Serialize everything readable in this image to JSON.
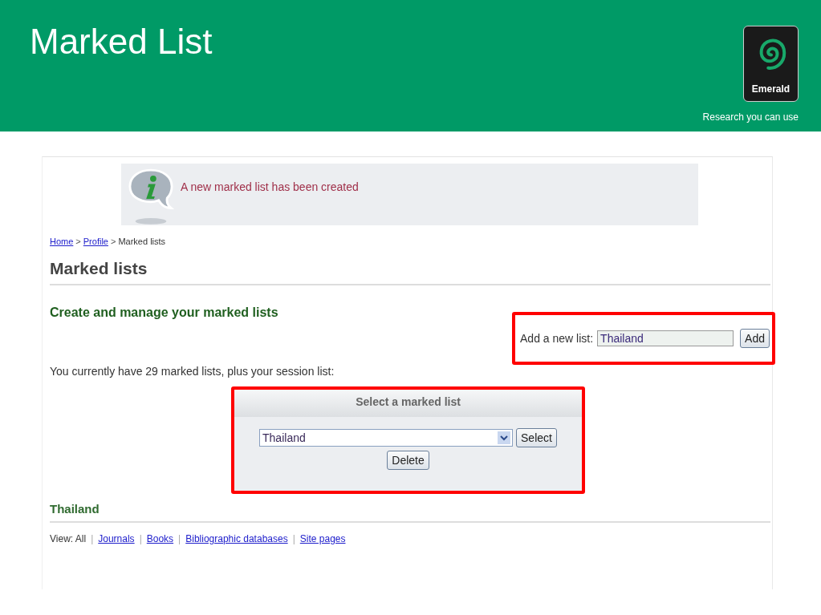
{
  "slide": {
    "title": "Marked List",
    "logo_text": "Emerald",
    "tagline": "Research you can use"
  },
  "notice": {
    "message": "A new marked list has been created"
  },
  "breadcrumb": [
    {
      "kind": "link",
      "text": "Home"
    },
    {
      "kind": "separator",
      "text": ">"
    },
    {
      "kind": "link",
      "text": "Profile"
    },
    {
      "kind": "separator",
      "text": ">"
    },
    {
      "kind": "text",
      "text": "Marked lists"
    }
  ],
  "page_title": "Marked lists",
  "section_title": "Create and manage your marked lists",
  "add_list": {
    "label": "Add a new list:",
    "value": "Thailand",
    "button": "Add",
    "highlighted": true
  },
  "summary": "You currently have 29 marked lists, plus your session list:",
  "select_panel": {
    "title": "Select a marked list",
    "selected_value": "Thailand",
    "select_button": "Select",
    "delete_button": "Delete",
    "highlighted": true
  },
  "current_list": {
    "title": "Thailand"
  },
  "view_filter": [
    {
      "kind": "text",
      "text": "View: All"
    },
    {
      "kind": "separator",
      "text": "|"
    },
    {
      "kind": "link",
      "text": "Journals"
    },
    {
      "kind": "separator",
      "text": "|"
    },
    {
      "kind": "link",
      "text": "Books"
    },
    {
      "kind": "separator",
      "text": "|"
    },
    {
      "kind": "link",
      "text": "Bibliographic databases"
    },
    {
      "kind": "separator",
      "text": "|"
    },
    {
      "kind": "link",
      "text": "Site pages"
    }
  ]
}
